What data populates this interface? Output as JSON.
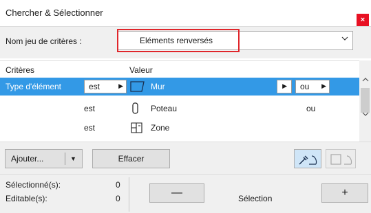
{
  "window": {
    "title": "Chercher & Sélectionner",
    "close_glyph": "×"
  },
  "criteria_set": {
    "label": "Nom jeu de critères :",
    "value": "Eléments renversés",
    "next_glyph": "▶"
  },
  "table": {
    "headers": {
      "criteria": "Critères",
      "value": "Valeur"
    },
    "rows": [
      {
        "criterion": "Type d'élément",
        "operator": "est",
        "icon": "wall-icon",
        "value": "Mur",
        "connector": "ou",
        "selected": true
      },
      {
        "criterion": "",
        "operator": "est",
        "icon": "column-icon",
        "value": "Poteau",
        "connector": "ou",
        "selected": false
      },
      {
        "criterion": "",
        "operator": "est",
        "icon": "zone-icon",
        "value": "Zone",
        "connector": "",
        "selected": false
      }
    ]
  },
  "toolbar": {
    "add_label": "Ajouter...",
    "clear_label": "Effacer"
  },
  "status": {
    "selected_label": "Sélectionné(s):",
    "selected_count": "0",
    "editable_label": "Editable(s):",
    "editable_count": "0",
    "minus_glyph": "—",
    "selection_label": "Sélection",
    "plus_glyph": "+"
  },
  "colors": {
    "selection": "#3399e6",
    "highlight_border": "#e0262b",
    "close": "#e81123"
  }
}
